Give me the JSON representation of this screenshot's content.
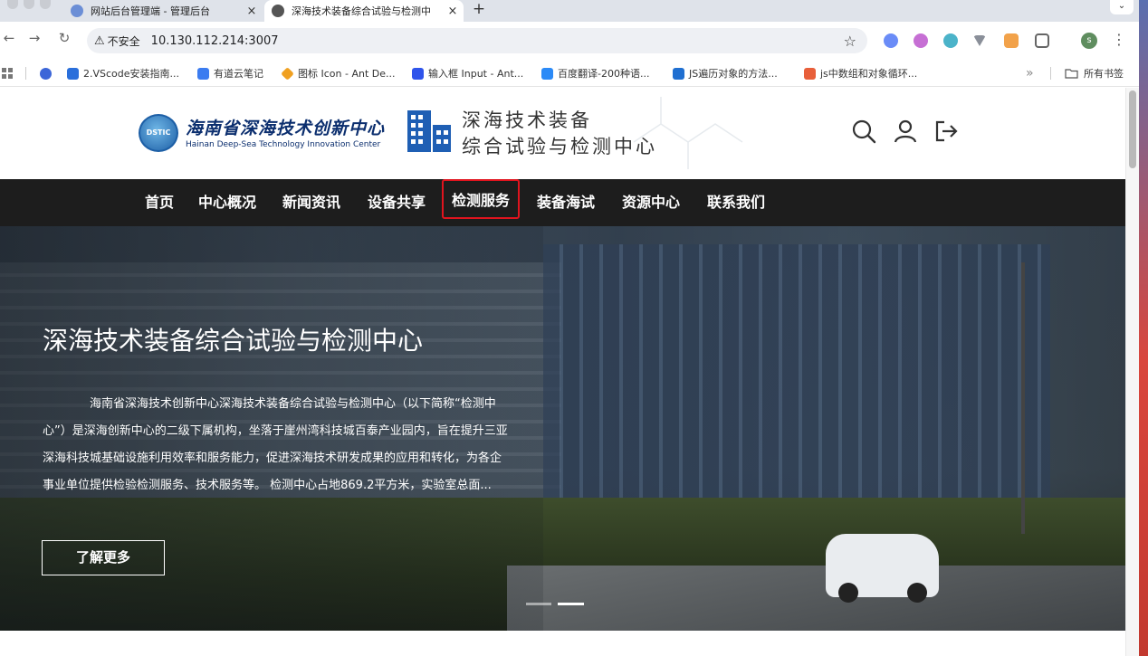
{
  "browser": {
    "tabs": [
      {
        "title": "网站后台管理端 - 管理后台",
        "close": "×"
      },
      {
        "title": "深海技术装备综合试验与检测中",
        "close": "×"
      }
    ],
    "new_tab": "+",
    "tab_menu": "⌄",
    "nav": {
      "back": "←",
      "forward": "→",
      "reload": "↻"
    },
    "security_label": "不安全",
    "url": "10.130.112.214:3007",
    "bookmark_star": "☆",
    "profile_initial": "s",
    "menu": "⋮",
    "bookmarks": [
      {
        "label": "2.VScode安装指南...",
        "color": "#2a6fdb"
      },
      {
        "label": "有道云笔记",
        "color": "#3b7cf0"
      },
      {
        "label": "图标 Icon - Ant De...",
        "color": "#f0a020"
      },
      {
        "label": "输入框 Input - Ant...",
        "color": "#2f54eb"
      },
      {
        "label": "百度翻译-200种语...",
        "color": "#2b8af7"
      },
      {
        "label": "JS遍历对象的方法...",
        "color": "#1f6fd1"
      },
      {
        "label": "js中数组和对象循环...",
        "color": "#e85f3a"
      }
    ],
    "bookmarks_more": "»",
    "all_bookmarks": "所有书签"
  },
  "header": {
    "logo_badge": "DSTIC",
    "logo_cn": "海南省深海技术创新中心",
    "logo_en": "Hainan Deep-Sea Technology Innovation Center",
    "subtitle_line1": "深海技术装备",
    "subtitle_line2": "综合试验与检测中心"
  },
  "nav": {
    "items": [
      {
        "label": "首页"
      },
      {
        "label": "中心概况"
      },
      {
        "label": "新闻资讯"
      },
      {
        "label": "设备共享"
      },
      {
        "label": "检测服务",
        "highlighted": true
      },
      {
        "label": "装备海试"
      },
      {
        "label": "资源中心"
      },
      {
        "label": "联系我们"
      }
    ],
    "highlight_color": "#e0141e"
  },
  "hero": {
    "title": "深海技术装备综合试验与检测中心",
    "description": "海南省深海技术创新中心深海技术装备综合试验与检测中心（以下简称“检测中心”）是深海创新中心的二级下属机构，坐落于崖州湾科技城百泰产业园内，旨在提升三亚深海科技城基础设施利用效率和服务能力，促进深海技术研发成果的应用和转化，为各企事业单位提供检验检测服务、技术服务等。 检测中心占地869.2平方米，实验室总面...",
    "more_button": "了解更多",
    "carousel_total": 2,
    "carousel_active": 2
  }
}
